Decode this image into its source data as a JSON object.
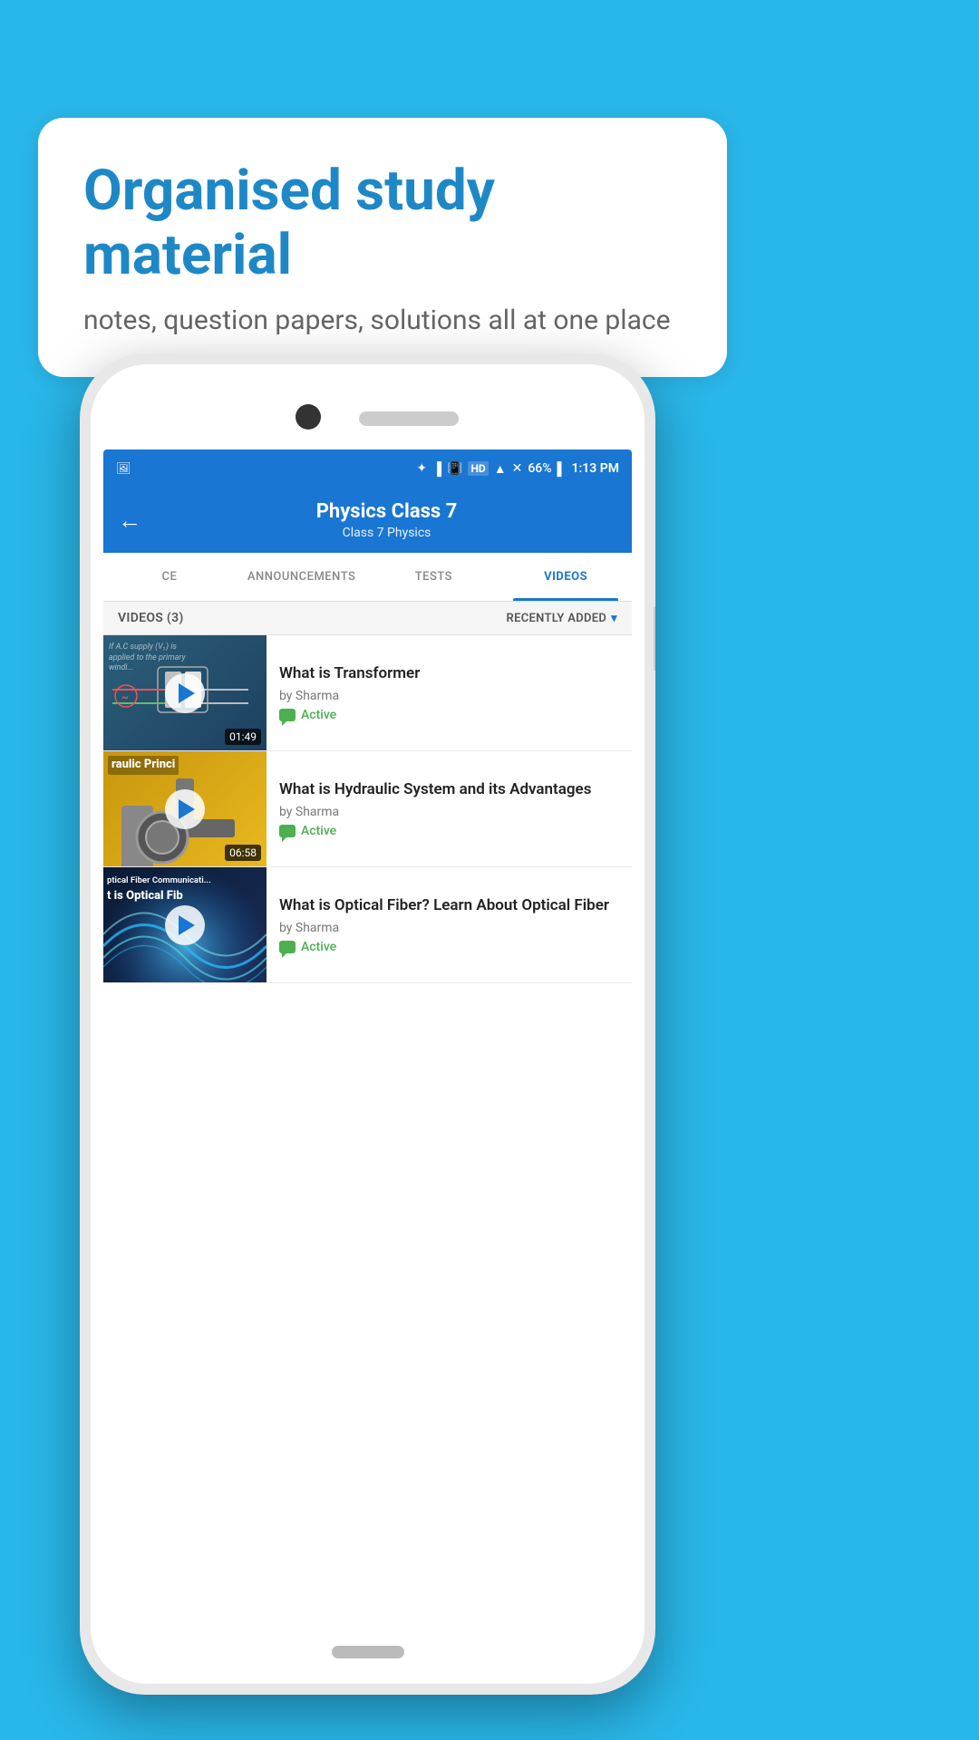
{
  "background_color": "#29b6e8",
  "speech_bubble": {
    "title": "Organised study material",
    "subtitle": "notes, question papers, solutions all at one place"
  },
  "phone": {
    "status_bar": {
      "time": "1:13 PM",
      "battery": "66%",
      "signal": "HD"
    },
    "app_bar": {
      "back_label": "←",
      "title": "Physics Class 7",
      "subtitle": "Class 7   Physics"
    },
    "tabs": [
      {
        "label": "CE",
        "active": false
      },
      {
        "label": "ANNOUNCEMENTS",
        "active": false
      },
      {
        "label": "TESTS",
        "active": false
      },
      {
        "label": "VIDEOS",
        "active": true
      }
    ],
    "videos_header": {
      "count_label": "VIDEOS (3)",
      "sort_label": "RECENTLY ADDED",
      "sort_icon": "▾"
    },
    "videos": [
      {
        "title": "What is  Transformer",
        "author": "by Sharma",
        "status": "Active",
        "duration": "01:49",
        "thumb_type": "1"
      },
      {
        "title": "What is Hydraulic System and its Advantages",
        "author": "by Sharma",
        "status": "Active",
        "duration": "06:58",
        "thumb_type": "2"
      },
      {
        "title": "What is Optical Fiber? Learn About Optical Fiber",
        "author": "by Sharma",
        "status": "Active",
        "duration": "",
        "thumb_type": "3"
      }
    ],
    "thumb_overlays": [
      "If A.C supply (V₁) is applied to the primary windi...",
      "raulic Princi",
      "ptical Fiber Communicati...\nt is Optical Fib"
    ]
  }
}
